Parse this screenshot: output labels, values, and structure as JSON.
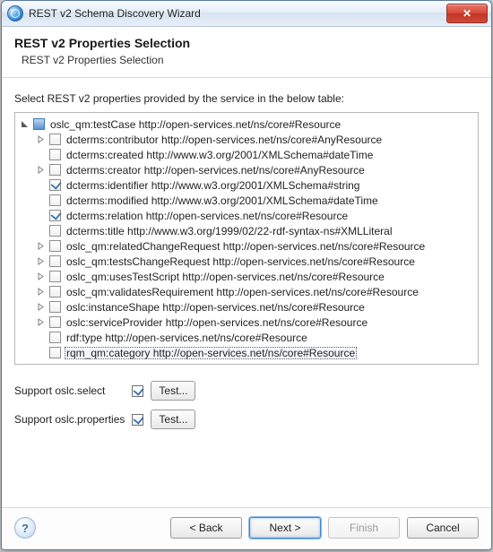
{
  "window": {
    "title": "REST v2 Schema Discovery Wizard",
    "close_glyph": "✕"
  },
  "header": {
    "title": "REST v2 Properties Selection",
    "subtitle": "REST v2 Properties Selection"
  },
  "instruction": "Select REST v2 properties provided by the service in the below table:",
  "tree": {
    "root": {
      "label": "oslc_qm:testCase http://open-services.net/ns/core#Resource",
      "expanded": true,
      "checked": "filled",
      "children": [
        {
          "label": "dcterms:contributor http://open-services.net/ns/core#AnyResource",
          "expandable": true,
          "checked": false
        },
        {
          "label": "dcterms:created http://www.w3.org/2001/XMLSchema#dateTime",
          "expandable": false,
          "checked": false
        },
        {
          "label": "dcterms:creator http://open-services.net/ns/core#AnyResource",
          "expandable": true,
          "checked": false
        },
        {
          "label": "dcterms:identifier http://www.w3.org/2001/XMLSchema#string",
          "expandable": false,
          "checked": true
        },
        {
          "label": "dcterms:modified http://www.w3.org/2001/XMLSchema#dateTime",
          "expandable": false,
          "checked": false
        },
        {
          "label": "dcterms:relation http://open-services.net/ns/core#Resource",
          "expandable": false,
          "checked": true
        },
        {
          "label": "dcterms:title http://www.w3.org/1999/02/22-rdf-syntax-ns#XMLLiteral",
          "expandable": false,
          "checked": false
        },
        {
          "label": "oslc_qm:relatedChangeRequest http://open-services.net/ns/core#Resource",
          "expandable": true,
          "checked": false
        },
        {
          "label": "oslc_qm:testsChangeRequest http://open-services.net/ns/core#Resource",
          "expandable": true,
          "checked": false
        },
        {
          "label": "oslc_qm:usesTestScript http://open-services.net/ns/core#Resource",
          "expandable": true,
          "checked": false
        },
        {
          "label": "oslc_qm:validatesRequirement http://open-services.net/ns/core#Resource",
          "expandable": true,
          "checked": false
        },
        {
          "label": "oslc:instanceShape http://open-services.net/ns/core#Resource",
          "expandable": true,
          "checked": false
        },
        {
          "label": "oslc:serviceProvider http://open-services.net/ns/core#Resource",
          "expandable": true,
          "checked": false
        },
        {
          "label": "rdf:type http://open-services.net/ns/core#Resource",
          "expandable": false,
          "checked": false
        },
        {
          "label": "rqm_qm:category http://open-services.net/ns/core#Resource",
          "expandable": false,
          "checked": false,
          "selected": true
        }
      ]
    }
  },
  "options": {
    "select_label": "Support oslc.select",
    "select_checked": true,
    "properties_label": "Support oslc.properties",
    "properties_checked": true,
    "test_label": "Test..."
  },
  "buttons": {
    "back": "< Back",
    "next": "Next >",
    "finish": "Finish",
    "cancel": "Cancel"
  },
  "help_glyph": "?"
}
